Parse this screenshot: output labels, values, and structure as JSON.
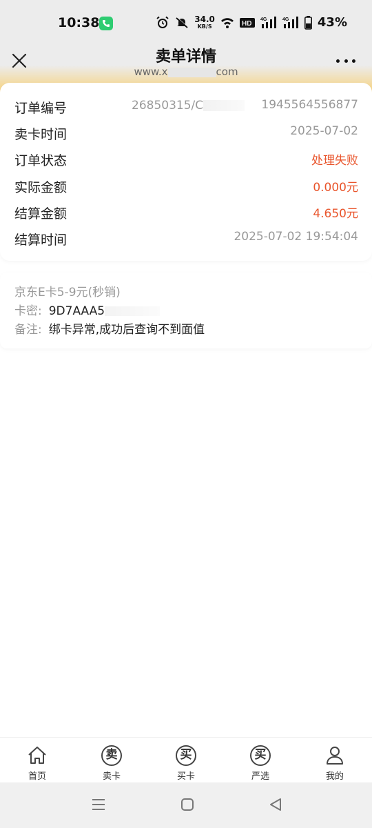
{
  "status_bar": {
    "time": "10:38",
    "net_speed_value": "34.0",
    "net_speed_unit": "KB/S",
    "hd_badge": "HD",
    "network_1": "4G",
    "network_2": "4G",
    "battery": "43%",
    "icons": [
      "phone-call-icon",
      "alarm-icon",
      "mute-icon",
      "wifi-icon",
      "hd-icon",
      "signal-icon",
      "signal-icon",
      "battery-icon"
    ]
  },
  "header": {
    "title": "卖单详情",
    "url_prefix": "www.x",
    "url_suffix": "com",
    "close_icon": "close-icon",
    "more_icon": "more-icon"
  },
  "order": {
    "rows": [
      {
        "label": "订单编号",
        "value_left": "26850315/C",
        "value": "1945564556877"
      },
      {
        "label": "卖卡时间",
        "value": "2025-07-02"
      },
      {
        "label": "订单状态",
        "value": "处理失败"
      },
      {
        "label": "实际金额",
        "value": "0.000元"
      },
      {
        "label": "结算金额",
        "value": "4.650元"
      },
      {
        "label": "结算时间",
        "value": "2025-07-02 19:54:04"
      }
    ],
    "accent_color": "#e9552c"
  },
  "product": {
    "name": "京东E卡5-9元(秒销)",
    "card_label": "卡密:",
    "card_value": "9D7AAA5",
    "note_label": "备注:",
    "note_value": "绑卡异常,成功后查询不到面值"
  },
  "bottom_nav": {
    "items": [
      {
        "label": "首页",
        "icon": "home-icon"
      },
      {
        "label": "卖卡",
        "icon": "sell-icon",
        "glyph": "卖"
      },
      {
        "label": "买卡",
        "icon": "buy-icon",
        "glyph": "买"
      },
      {
        "label": "严选",
        "icon": "select-icon",
        "glyph": "买"
      },
      {
        "label": "我的",
        "icon": "user-icon"
      }
    ]
  },
  "system_nav": [
    "menu-icon",
    "home-square-icon",
    "back-icon"
  ]
}
